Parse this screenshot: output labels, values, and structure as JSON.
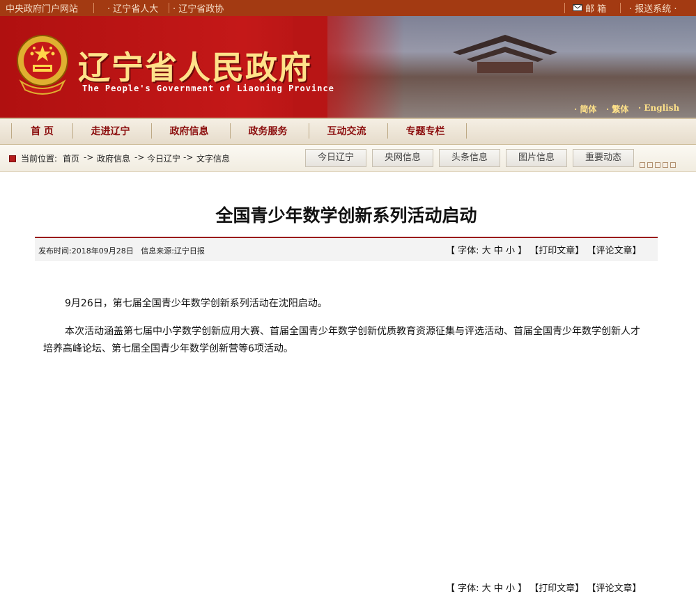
{
  "topbar": {
    "left_links": [
      "中央政府门户网站",
      "· 辽宁省人大",
      "· 辽宁省政协"
    ],
    "mail": "邮 箱",
    "report": "· 报送系统 ·"
  },
  "banner": {
    "title_cn": "辽宁省人民政府",
    "title_en": "The People's Government of Liaoning Province",
    "lang": [
      "· 简体",
      "· 繁体",
      "· English"
    ]
  },
  "nav": [
    "首 页",
    "走进辽宁",
    "政府信息",
    "政务服务",
    "互动交流",
    "专题专栏"
  ],
  "breadcrumb": {
    "label": "当前位置:",
    "items": [
      "首页",
      "政府信息",
      "今日辽宁",
      "文字信息"
    ],
    "arrow": "->"
  },
  "tabs": [
    "今日辽宁",
    "央网信息",
    "头条信息",
    "图片信息",
    "重要动态"
  ],
  "article": {
    "title": "全国青少年数学创新系列活动启动",
    "publish_label": "发布时间:",
    "publish_date": "2018年09月28日",
    "source_label": "信息来源:",
    "source": "辽宁日报",
    "paragraphs": [
      "9月26日，第七届全国青少年数学创新系列活动在沈阳启动。",
      "本次活动涵盖第七届中小学数学创新应用大赛、首届全国青少年数学创新优质教育资源征集与评选活动、首届全国青少年数学创新人才培养高峰论坛、第七届全国青少年数学创新营等6项活动。"
    ]
  },
  "controls": {
    "font_label": "【 字体:",
    "large": "大",
    "medium": "中",
    "small": "小",
    "font_end": "】",
    "print": "【打印文章】",
    "comment": "【评论文章】"
  },
  "colors": {
    "topbar": "#a33a12",
    "banner_red": "#c41818",
    "nav_text": "#8b0d0d",
    "gold": "#ffe28a"
  }
}
